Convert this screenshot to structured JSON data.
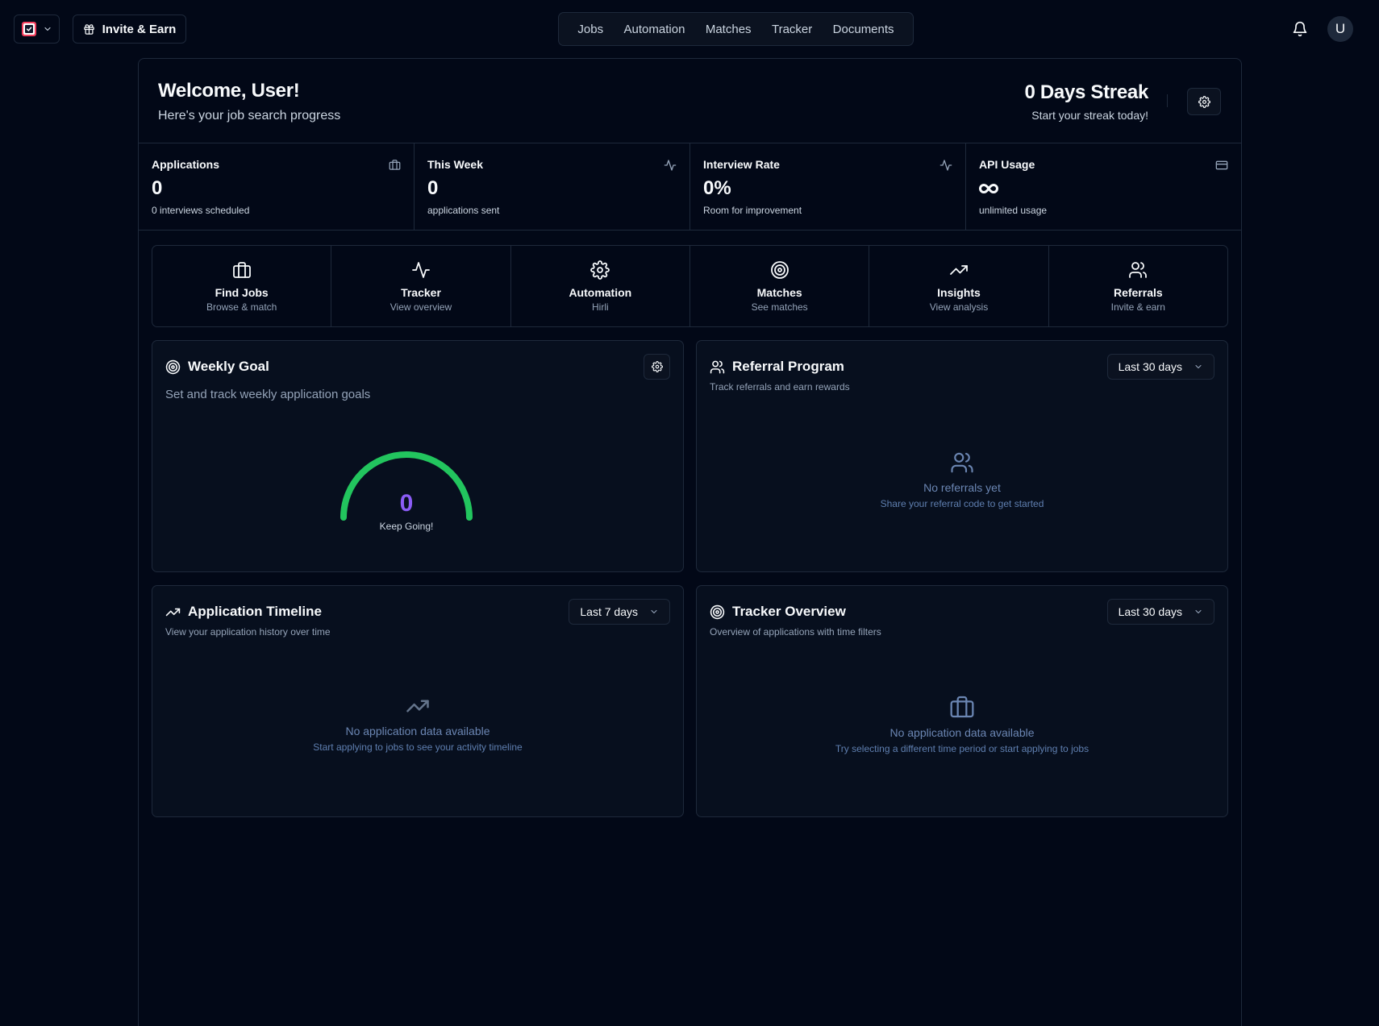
{
  "header": {
    "invite_label": "Invite & Earn",
    "nav": [
      {
        "label": "Jobs"
      },
      {
        "label": "Automation"
      },
      {
        "label": "Matches"
      },
      {
        "label": "Tracker"
      },
      {
        "label": "Documents"
      }
    ],
    "avatar_initial": "U"
  },
  "welcome": {
    "title": "Welcome, User!",
    "subtitle": "Here's your job search progress"
  },
  "streak": {
    "title": "0 Days Streak",
    "subtitle": "Start your streak today!"
  },
  "stats": [
    {
      "label": "Applications",
      "value": "0",
      "desc": "0 interviews scheduled",
      "icon": "briefcase-icon"
    },
    {
      "label": "This Week",
      "value": "0",
      "desc": "applications sent",
      "icon": "activity-icon"
    },
    {
      "label": "Interview Rate",
      "value": "0%",
      "desc": "Room for improvement",
      "icon": "activity-icon"
    },
    {
      "label": "API Usage",
      "value": "",
      "desc": "unlimited usage",
      "icon": "credit-card-icon"
    }
  ],
  "quick_actions": [
    {
      "title": "Find Jobs",
      "subtitle": "Browse & match",
      "icon": "briefcase-icon"
    },
    {
      "title": "Tracker",
      "subtitle": "View overview",
      "icon": "activity-icon"
    },
    {
      "title": "Automation",
      "subtitle": "Hirli",
      "icon": "gear-icon"
    },
    {
      "title": "Matches",
      "subtitle": "See matches",
      "icon": "target-icon"
    },
    {
      "title": "Insights",
      "subtitle": "View analysis",
      "icon": "trending-up-icon"
    },
    {
      "title": "Referrals",
      "subtitle": "Invite & earn",
      "icon": "users-icon"
    }
  ],
  "weekly_goal": {
    "title": "Weekly Goal",
    "subtitle": "Set and track weekly application goals",
    "value": "0",
    "label": "Keep Going!",
    "gauge_color": "#22c55e"
  },
  "referral": {
    "title": "Referral Program",
    "subtitle": "Track referrals and earn rewards",
    "range": "Last 30 days",
    "empty_title": "No referrals yet",
    "empty_sub": "Share your referral code to get started"
  },
  "timeline": {
    "title": "Application Timeline",
    "subtitle": "View your application history over time",
    "range": "Last 7 days",
    "empty_title": "No application data available",
    "empty_sub": "Start applying to jobs to see your activity timeline"
  },
  "tracker": {
    "title": "Tracker Overview",
    "subtitle": "Overview of applications with time filters",
    "range": "Last 30 days",
    "empty_title": "No application data available",
    "empty_sub": "Try selecting a different time period or start applying to jobs"
  },
  "colors": {
    "background": "#020817",
    "border": "#1e293b",
    "accent_purple": "#8b5cf6",
    "accent_green": "#22c55e",
    "muted_blue": "#6b86b3"
  }
}
